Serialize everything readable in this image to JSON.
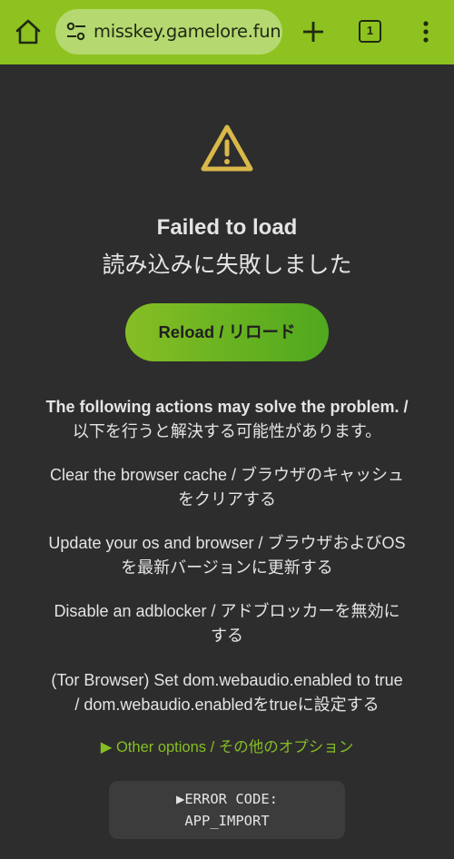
{
  "browser": {
    "url": "misskey.gamelore.fun",
    "tab_count": "1",
    "icons": [
      "home-icon",
      "site-settings-icon",
      "new-tab-icon",
      "tab-switcher-icon",
      "more-menu-icon"
    ],
    "accent_color": "#8ec220"
  },
  "error_page": {
    "icon": "warning-icon",
    "title": "Failed to load",
    "subtitle": "読み込みに失敗しました",
    "reload_label": "Reload / リロード",
    "actions_heading_en": "The following actions may solve the problem. /",
    "actions_heading_jp": "以下を行うと解決する可能性があります。",
    "actions": [
      {
        "line1": "Clear the browser cache / ブラウザのキャッシュ",
        "line2": "をクリアする"
      },
      {
        "line1": "Update your os and browser / ブラウザおよびOS",
        "line2": "を最新バージョンに更新する"
      },
      {
        "line1": "Disable an adblocker / アドブロッカーを無効に",
        "line2": "する"
      },
      {
        "line1": "(Tor Browser) Set dom.webaudio.enabled to true",
        "line2": "/ dom.webaudio.enabledをtrueに設定する"
      }
    ],
    "other_options": "▶ Other options / その他のオプション",
    "error_code_label": "▶ERROR CODE:",
    "error_code": "APP_IMPORT",
    "background_color": "#2d2d2d",
    "button_gradient": [
      "#86be24",
      "#4fa81e"
    ]
  }
}
